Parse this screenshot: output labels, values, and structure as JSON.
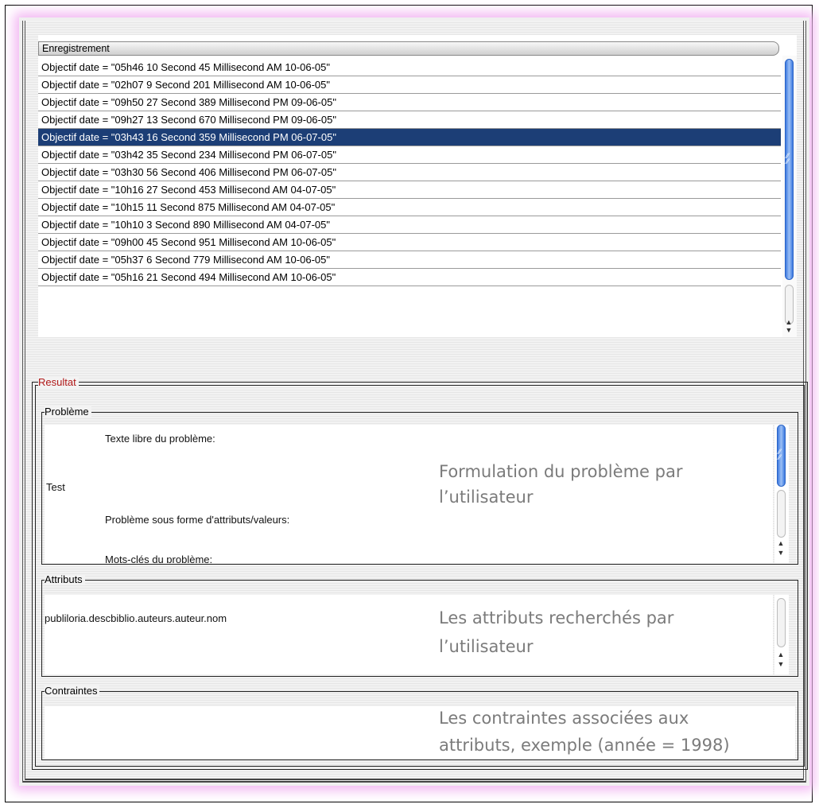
{
  "list": {
    "header": "Enregistrement",
    "rows": [
      "Objectif date = \"05h46 10 Second  45 Millisecond  AM 10-06-05\"",
      "Objectif date = \"02h07 9 Second  201 Millisecond  AM 10-06-05\"",
      "Objectif date = \"09h50 27 Second  389 Millisecond  PM 09-06-05\"",
      "Objectif date = \"09h27 13 Second  670 Millisecond  PM 09-06-05\"",
      "Objectif date = \"03h43 16 Second  359 Millisecond  PM 06-07-05\"",
      "Objectif date = \"03h42 35 Second  234 Millisecond  PM 06-07-05\"",
      "Objectif date = \"03h30 56 Second  406 Millisecond  PM 06-07-05\"",
      "Objectif date = \"10h16 27 Second  453 Millisecond  AM 04-07-05\"",
      "Objectif date = \"10h15 11 Second  875 Millisecond  AM 04-07-05\"",
      "Objectif date = \"10h10 3 Second  890 Millisecond  AM 04-07-05\"",
      "Objectif date = \"09h00 45 Second  951 Millisecond  AM 10-06-05\"",
      "Objectif date = \"05h37 6 Second  779 Millisecond  AM 10-06-05\"",
      "Objectif date = \"05h16 21 Second  494 Millisecond  AM 10-06-05\""
    ],
    "selected_index": 4
  },
  "resultat": {
    "legend": "Resultat",
    "legend_color": "#b01818",
    "probleme": {
      "legend": "Problème",
      "free_text_label": "Texte libre du problème:",
      "free_text_value": "Test",
      "attr_values_label": "Problème sous forme d'attributs/valeurs:",
      "keywords_label": "Mots-clés du problème:",
      "annotation_line1": "Formulation du problème par",
      "annotation_line2": "l’utilisateur"
    },
    "attributs": {
      "legend": "Attributs",
      "value": "publiloria.descbiblio.auteurs.auteur.nom",
      "annotation_line1": "Les attributs recherchés par",
      "annotation_line2": "l’utilisateur"
    },
    "contraintes": {
      "legend": "Contraintes",
      "annotation_line1": "Les contraintes associées aux",
      "annotation_line2": "attributs, exemple (année = 1998)"
    }
  },
  "colors": {
    "selection": "#1c3e76",
    "scroll_thumb": "#3c79e0",
    "glow": "#f3b8f3"
  },
  "icons": [
    "scroll-up-arrow-icon",
    "scroll-down-arrow-icon",
    "scroll-grip-icon"
  ]
}
